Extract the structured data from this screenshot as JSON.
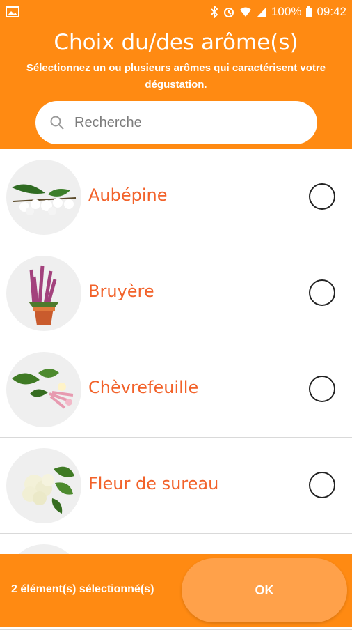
{
  "status_bar": {
    "battery": "100%",
    "time": "09:42",
    "icons": [
      "image-icon",
      "bluetooth-icon",
      "alarm-icon",
      "wifi-icon",
      "signal-icon",
      "battery-icon"
    ]
  },
  "header": {
    "title": "Choix du/des arôme(s)",
    "subtitle": "Sélectionnez un ou plusieurs arômes qui caractérisent votre dégustation."
  },
  "search": {
    "placeholder": "Recherche",
    "icon": "search-icon"
  },
  "items": [
    {
      "label": "Aubépine",
      "selected": false,
      "image": "hawthorn-flower"
    },
    {
      "label": "Bruyère",
      "selected": false,
      "image": "heather-plant"
    },
    {
      "label": "Chèvrefeuille",
      "selected": false,
      "image": "honeysuckle-flower"
    },
    {
      "label": "Fleur de sureau",
      "selected": false,
      "image": "elderflower"
    }
  ],
  "footer": {
    "count_text": "2 élément(s) sélectionné(s)",
    "ok_label": "OK"
  },
  "colors": {
    "primary": "#ff8a12",
    "accent_text": "#f2622a",
    "button": "#ffa14a"
  }
}
